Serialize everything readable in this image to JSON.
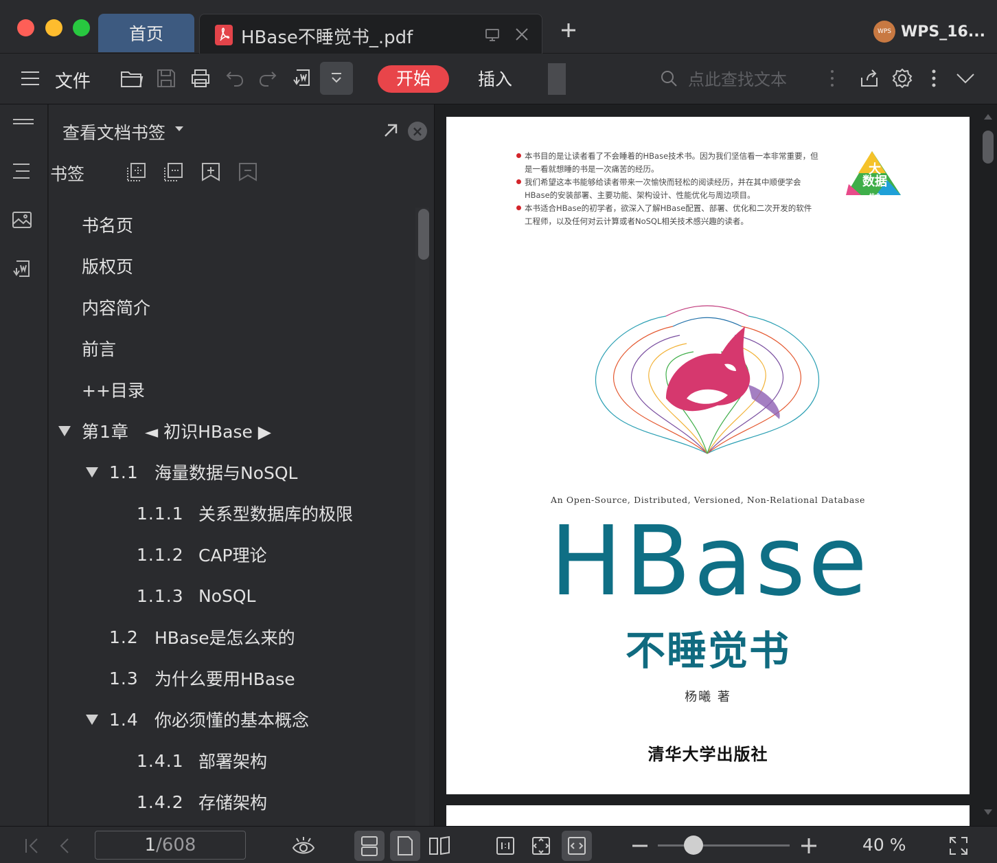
{
  "titlebar": {
    "tabs": [
      {
        "label": "首页"
      },
      {
        "label": "HBase不睡觉书_.pdf",
        "icon": "pdf-file-icon"
      }
    ],
    "account_name": "WPS_16...",
    "avatar_text": "WPS"
  },
  "toolbar": {
    "file_label": "文件",
    "start_label": "开始",
    "insert_label": "插入",
    "search_placeholder": "点此查找文本"
  },
  "panel": {
    "title": "查看文档书签",
    "bookmarks_label": "书签",
    "items": [
      {
        "num": "",
        "label": "书名页",
        "level": 0,
        "expandable": false
      },
      {
        "num": "",
        "label": "版权页",
        "level": 0,
        "expandable": false
      },
      {
        "num": "",
        "label": "内容简介",
        "level": 0,
        "expandable": false
      },
      {
        "num": "",
        "label": "前言",
        "level": 0,
        "expandable": false
      },
      {
        "num": "",
        "label": "++目录",
        "level": 0,
        "expandable": false
      },
      {
        "num": "第1章",
        "label": "◄ 初识HBase ▶",
        "level": 0,
        "expandable": true
      },
      {
        "num": "1.1",
        "label": "海量数据与NoSQL",
        "level": 1,
        "expandable": true
      },
      {
        "num": "1.1.1",
        "label": "关系型数据库的极限",
        "level": 2,
        "expandable": false
      },
      {
        "num": "1.1.2",
        "label": "CAP理论",
        "level": 2,
        "expandable": false
      },
      {
        "num": "1.1.3",
        "label": "NoSQL",
        "level": 2,
        "expandable": false
      },
      {
        "num": "1.2",
        "label": "HBase是怎么来的",
        "level": 1,
        "expandable": false
      },
      {
        "num": "1.3",
        "label": "为什么要用HBase",
        "level": 1,
        "expandable": false
      },
      {
        "num": "1.4",
        "label": "你必须懂的基本概念",
        "level": 1,
        "expandable": true
      },
      {
        "num": "1.4.1",
        "label": "部署架构",
        "level": 2,
        "expandable": false
      },
      {
        "num": "1.4.2",
        "label": "存储架构",
        "level": 2,
        "expandable": false
      }
    ]
  },
  "page": {
    "blurbs": [
      "本书目的是让读者看了不会睡着的HBase技术书。因为我们坚信看一本非常重要，但是一看就想睡的书是一次痛苦的经历。",
      "我们希望这本书能够给读者带来一次愉快而轻松的阅读经历，并在其中顺便学会HBase的安装部署、主要功能、架构设计、性能优化与周边项目。",
      "本书适合HBase的初学者，欲深入了解HBase配置、部署、优化和二次开发的软件工程师，以及任何对云计算或者NoSQL相关技术感兴趣的读者。"
    ],
    "badge": {
      "line1": "大",
      "line2": "数据",
      "line3": "技术"
    },
    "subtitle": "An Open-Source, Distributed, Versioned, Non-Relational Database",
    "title": "HBase",
    "cn_title": "不睡觉书",
    "author": "杨曦 著",
    "publisher": "清华大学出版社"
  },
  "statusbar": {
    "current_page": "1",
    "total_pages": "/608",
    "zoom": "40 %",
    "zoom_fraction": 0.27
  },
  "colors": {
    "start_tab": "#e8454a",
    "home_tab": "#3d5a80",
    "title_teal": "#0f6f85",
    "blurb_bullet": "#d3242a"
  }
}
